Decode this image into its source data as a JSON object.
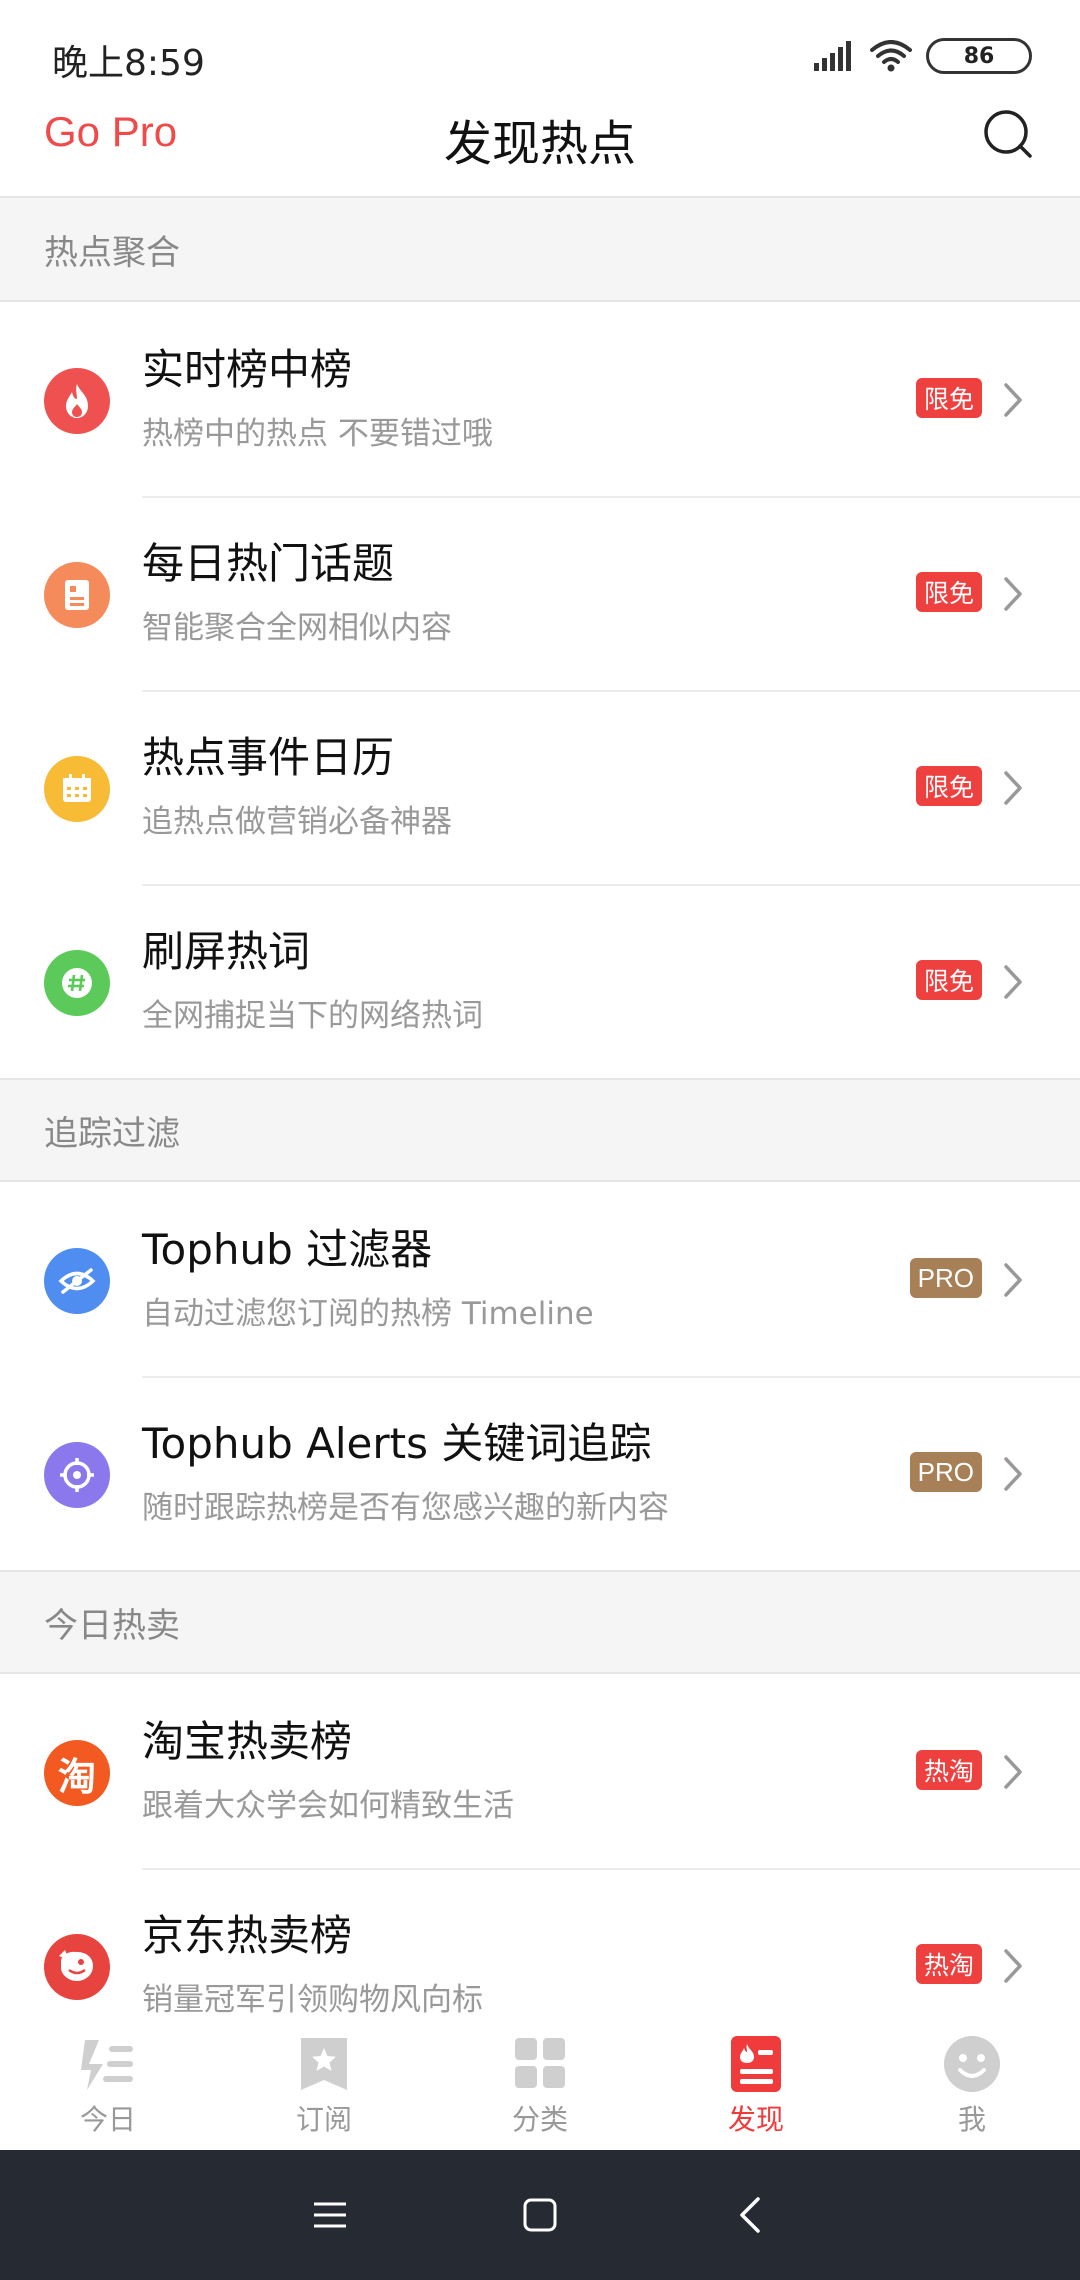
{
  "status_bar": {
    "time": "晚上8:59",
    "battery": "86"
  },
  "header": {
    "go_pro": "Go Pro",
    "title": "发现热点"
  },
  "sections": [
    {
      "title": "热点聚合",
      "items": [
        {
          "title": "实时榜中榜",
          "subtitle": "热榜中的热点 不要错过哦",
          "badge": "限免",
          "icon": "fire-icon",
          "color": "#ef5050"
        },
        {
          "title": "每日热门话题",
          "subtitle": "智能聚合全网相似内容",
          "badge": "限免",
          "icon": "document-icon",
          "color": "#f58a5a"
        },
        {
          "title": "热点事件日历",
          "subtitle": "追热点做营销必备神器",
          "badge": "限免",
          "icon": "calendar-icon",
          "color": "#f7bb35"
        },
        {
          "title": "刷屏热词",
          "subtitle": "全网捕捉当下的网络热词",
          "badge": "限免",
          "icon": "hashtag-icon",
          "color": "#5cca5a"
        }
      ]
    },
    {
      "title": "追踪过滤",
      "items": [
        {
          "title": "Tophub 过滤器",
          "subtitle": "自动过滤您订阅的热榜 Timeline",
          "badge": "PRO",
          "icon": "eye-off-icon",
          "color": "#4f8ef0"
        },
        {
          "title": "Tophub Alerts 关键词追踪",
          "subtitle": "随时跟踪热榜是否有您感兴趣的新内容",
          "badge": "PRO",
          "icon": "target-icon",
          "color": "#8b78ec"
        }
      ]
    },
    {
      "title": "今日热卖",
      "items": [
        {
          "title": "淘宝热卖榜",
          "subtitle": "跟着大众学会如何精致生活",
          "badge": "热淘",
          "icon": "taobao-icon",
          "icon_text": "淘",
          "color": "#f25a22"
        },
        {
          "title": "京东热卖榜",
          "subtitle": "销量冠军引领购物风向标",
          "badge": "热淘",
          "icon": "jd-dog-icon",
          "color": "#e8443f"
        }
      ]
    }
  ],
  "tabs": [
    {
      "label": "今日",
      "icon": "today-icon",
      "active": false
    },
    {
      "label": "订阅",
      "icon": "subscribe-star-icon",
      "active": false
    },
    {
      "label": "分类",
      "icon": "category-grid-icon",
      "active": false
    },
    {
      "label": "发现",
      "icon": "discover-icon",
      "active": true
    },
    {
      "label": "我",
      "icon": "smiley-face-icon",
      "active": false
    }
  ],
  "colors": {
    "accent": "#ef4b4b",
    "pro_badge": "#a88058",
    "free_badge": "#ef4040",
    "nav_bar": "#262a33"
  }
}
